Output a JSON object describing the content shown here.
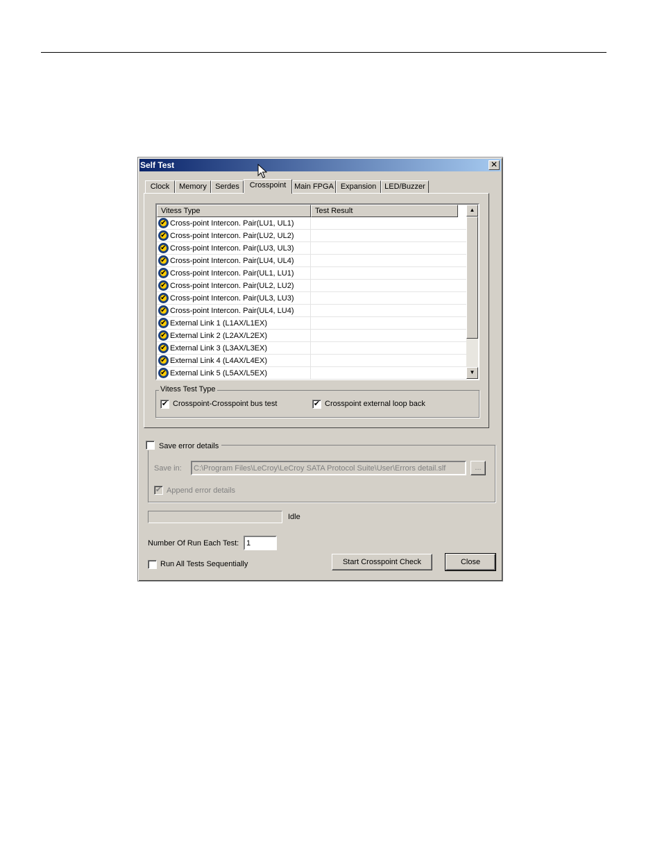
{
  "window": {
    "title": "Self Test",
    "close_glyph": "✕"
  },
  "tabs": [
    {
      "label": "Clock",
      "active": false
    },
    {
      "label": "Memory",
      "active": false
    },
    {
      "label": "Serdes",
      "active": false
    },
    {
      "label": "Crosspoint",
      "active": true
    },
    {
      "label": "Main FPGA",
      "active": false
    },
    {
      "label": "Expansion",
      "active": false
    },
    {
      "label": "LED/Buzzer",
      "active": false
    }
  ],
  "list": {
    "columns": [
      "Vitess Type",
      "Test Result"
    ],
    "rows": [
      {
        "type": "Cross-point Intercon. Pair(LU1, UL1)",
        "result": ""
      },
      {
        "type": "Cross-point Intercon. Pair(LU2, UL2)",
        "result": ""
      },
      {
        "type": "Cross-point Intercon. Pair(LU3, UL3)",
        "result": ""
      },
      {
        "type": "Cross-point Intercon. Pair(LU4, UL4)",
        "result": ""
      },
      {
        "type": "Cross-point Intercon. Pair(UL1, LU1)",
        "result": ""
      },
      {
        "type": "Cross-point Intercon. Pair(UL2, LU2)",
        "result": ""
      },
      {
        "type": "Cross-point Intercon. Pair(UL3, LU3)",
        "result": ""
      },
      {
        "type": "Cross-point Intercon. Pair(UL4, LU4)",
        "result": ""
      },
      {
        "type": "External Link 1 (L1AX/L1EX)",
        "result": ""
      },
      {
        "type": "External Link 2 (L2AX/L2EX)",
        "result": ""
      },
      {
        "type": "External Link 3 (L3AX/L3EX)",
        "result": ""
      },
      {
        "type": "External Link 4 (L4AX/L4EX)",
        "result": ""
      },
      {
        "type": "External Link 5 (L5AX/L5EX)",
        "result": ""
      }
    ],
    "row_icon": "check-shield-icon",
    "scroll_up_glyph": "▲",
    "scroll_down_glyph": "▼"
  },
  "test_type": {
    "legend": "Vitess Test Type",
    "option1": {
      "label": "Crosspoint-Crosspoint bus test",
      "checked": true
    },
    "option2": {
      "label": "Crosspoint external loop back",
      "checked": true
    }
  },
  "save_errors": {
    "label": "Save error details",
    "checked": false,
    "save_in_label": "Save in:",
    "path": "C:\\Program Files\\LeCroy\\LeCroy SATA Protocol Suite\\User\\Errors detail.slf",
    "browse_label": "...",
    "append_label": "Append error details",
    "append_checked": true
  },
  "status": {
    "text": "Idle",
    "progress": 0
  },
  "runs": {
    "label": "Number Of Run Each Test:",
    "value": "1"
  },
  "run_all": {
    "label": "Run All Tests Sequentially",
    "checked": false
  },
  "buttons": {
    "start": "Start Crosspoint Check",
    "close": "Close"
  },
  "check_glyph": "✔"
}
